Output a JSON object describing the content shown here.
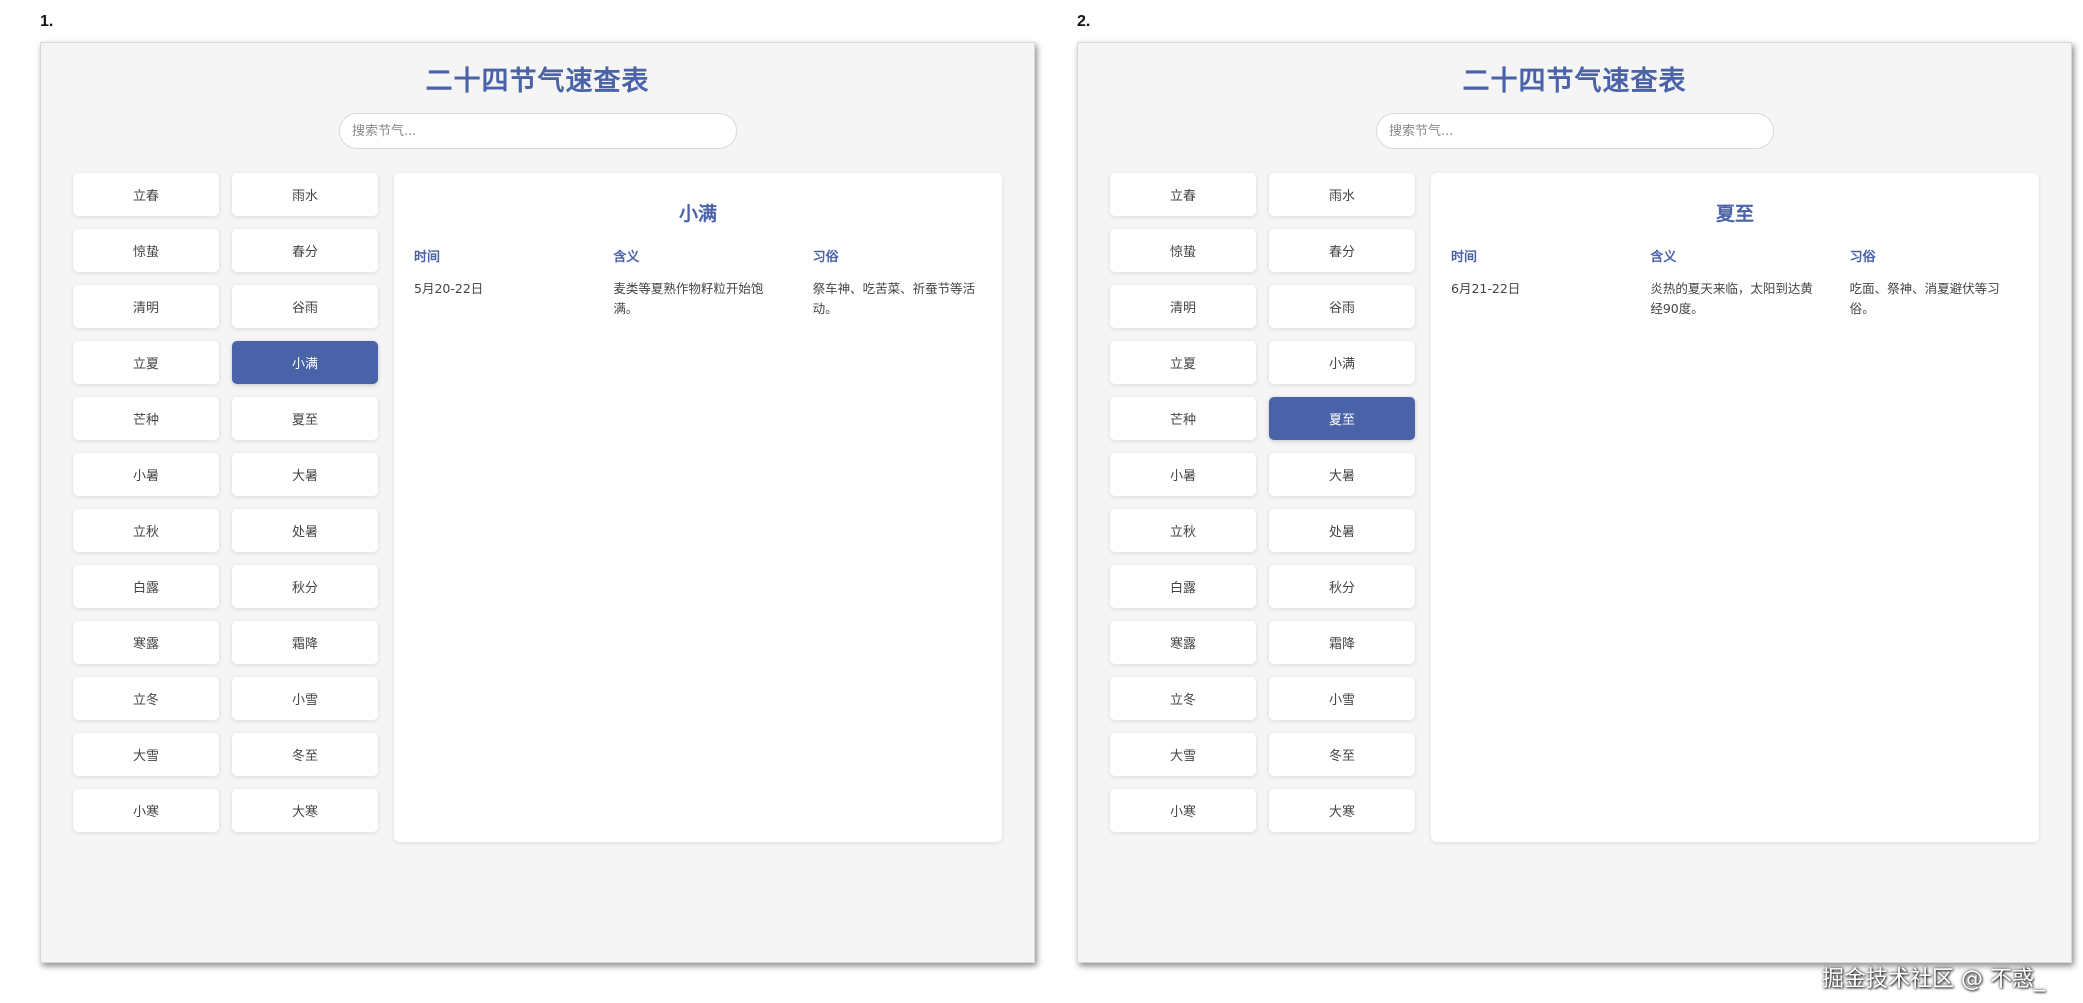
{
  "panels": [
    {
      "number": "1.",
      "title": "二十四节气速查表",
      "search_placeholder": "搜索节气...",
      "terms": [
        "立春",
        "雨水",
        "惊蛰",
        "春分",
        "清明",
        "谷雨",
        "立夏",
        "小满",
        "芒种",
        "夏至",
        "小暑",
        "大暑",
        "立秋",
        "处暑",
        "白露",
        "秋分",
        "寒露",
        "霜降",
        "立冬",
        "小雪",
        "大雪",
        "冬至",
        "小寒",
        "大寒"
      ],
      "selected": "小满",
      "detail": {
        "name": "小满",
        "time_label": "时间",
        "meaning_label": "含义",
        "custom_label": "习俗",
        "time": "5月20-22日",
        "meaning": "麦类等夏熟作物籽粒开始饱满。",
        "custom": "祭车神、吃苦菜、祈蚕节等活动。"
      }
    },
    {
      "number": "2.",
      "title": "二十四节气速查表",
      "search_placeholder": "搜索节气...",
      "terms": [
        "立春",
        "雨水",
        "惊蛰",
        "春分",
        "清明",
        "谷雨",
        "立夏",
        "小满",
        "芒种",
        "夏至",
        "小暑",
        "大暑",
        "立秋",
        "处暑",
        "白露",
        "秋分",
        "寒露",
        "霜降",
        "立冬",
        "小雪",
        "大雪",
        "冬至",
        "小寒",
        "大寒"
      ],
      "selected": "夏至",
      "detail": {
        "name": "夏至",
        "time_label": "时间",
        "meaning_label": "含义",
        "custom_label": "习俗",
        "time": "6月21-22日",
        "meaning": "炎热的夏天来临，太阳到达黄经90度。",
        "custom": "吃面、祭神、消夏避伏等习俗。"
      }
    }
  ],
  "watermark": "掘金技术社区 @ 不惑_",
  "colors": {
    "accent": "#4a63a8",
    "page_bg": "#f5f5f5",
    "card_bg": "#ffffff"
  }
}
